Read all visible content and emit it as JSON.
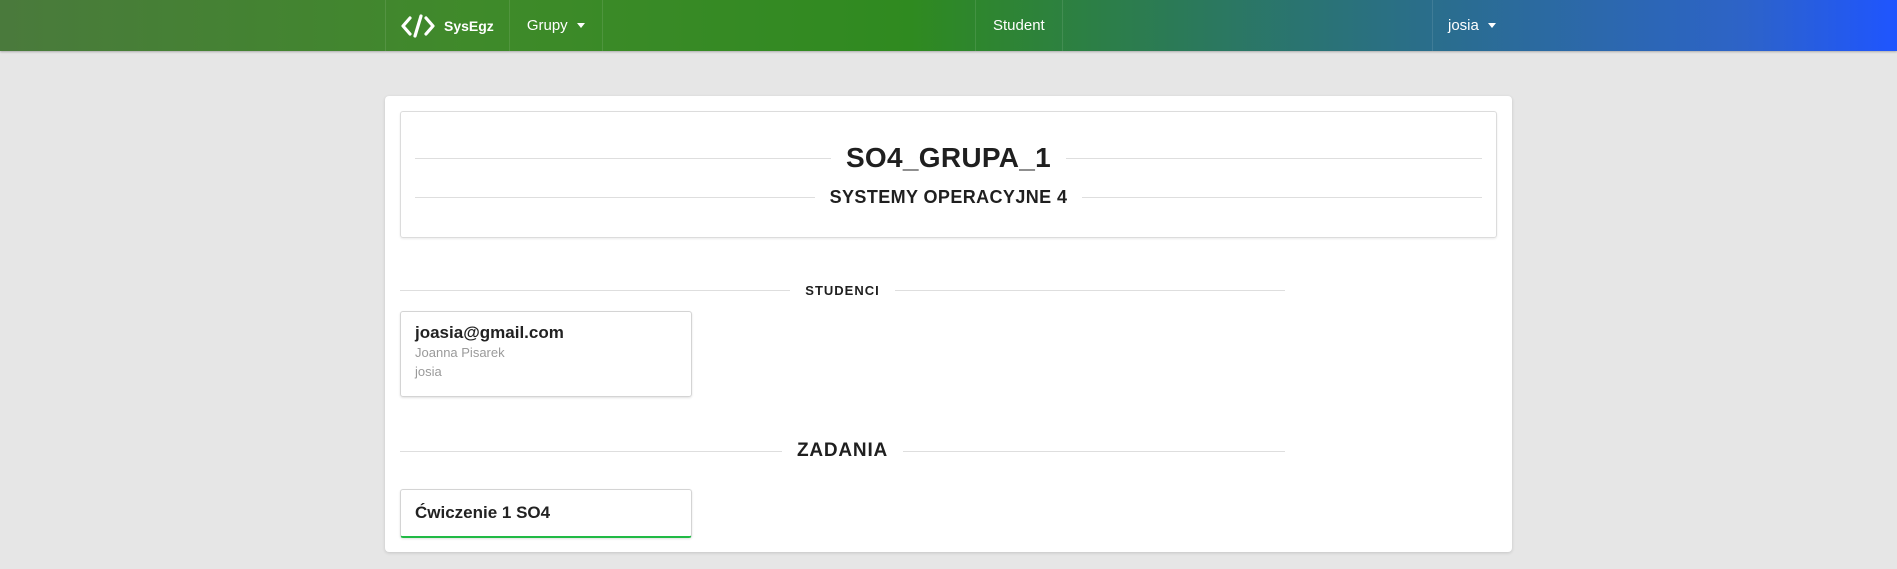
{
  "navbar": {
    "brand": "SysEgz",
    "brand_icon": "code-icon",
    "groups_label": "Grupy",
    "role_label": "Student",
    "user_label": "josia"
  },
  "group": {
    "title": "SO4_GRUPA_1",
    "course": "SYSTEMY OPERACYJNE 4"
  },
  "students": {
    "heading": "STUDENCI",
    "items": [
      {
        "email": "joasia@gmail.com",
        "full_name": "Joanna Pisarek",
        "username": "josia"
      }
    ]
  },
  "tasks": {
    "heading": "ZADANIA",
    "items": [
      {
        "name": "Ćwiczenie 1 SO4",
        "accent_color": "#21ba45"
      }
    ]
  }
}
